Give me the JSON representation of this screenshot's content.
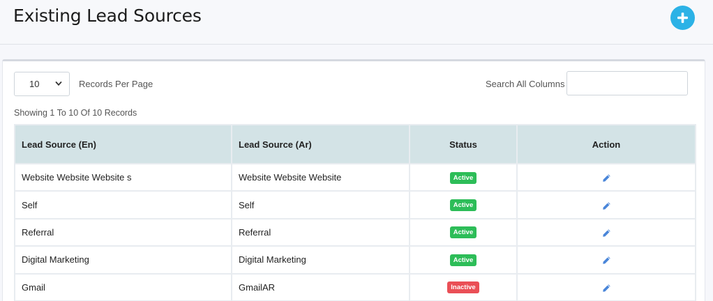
{
  "header": {
    "title": "Existing Lead Sources",
    "add_icon": "plus-circle-icon",
    "accent": "#2cb2e6"
  },
  "controls": {
    "page_size": "10",
    "records_per_page_label": "Records Per Page",
    "search_label": "Search All Columns",
    "search_value": "",
    "showing_text": "Showing 1 To 10 Of 10 Records"
  },
  "table": {
    "columns": [
      "Lead Source (En)",
      "Lead Source (Ar)",
      "Status",
      "Action"
    ],
    "rows": [
      {
        "en": "Website Website Website s",
        "ar": "Website Website Website",
        "status": "Active"
      },
      {
        "en": "Self",
        "ar": "Self",
        "status": "Active"
      },
      {
        "en": "Referral",
        "ar": "Referral",
        "status": "Active"
      },
      {
        "en": "Digital Marketing",
        "ar": "Digital Marketing",
        "status": "Active"
      },
      {
        "en": "Gmail",
        "ar": "GmailAR",
        "status": "Inactive"
      }
    ],
    "status_colors": {
      "Active": "#2dbd58",
      "Inactive": "#ea4f56"
    },
    "action_icon": "pencil-icon",
    "header_bg": "#d3e3e6"
  }
}
